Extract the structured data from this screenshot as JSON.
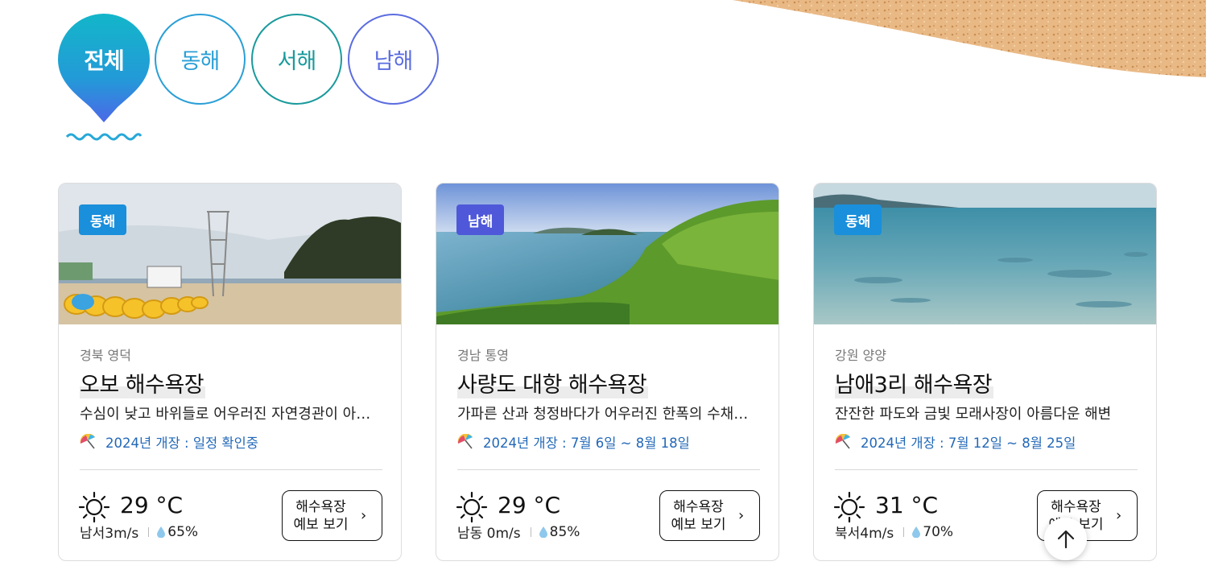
{
  "tabs": [
    {
      "label": "전체",
      "active": true
    },
    {
      "label": "동해",
      "active": false
    },
    {
      "label": "서해",
      "active": false
    },
    {
      "label": "남해",
      "active": false
    }
  ],
  "colors": {
    "east": "#1a8fdb",
    "south": "#4f58d9",
    "link": "#2268b8"
  },
  "cards": [
    {
      "badge": "동해",
      "region": "경북 영덕",
      "name": "오보 해수욕장",
      "description": "수심이 낮고 바위들로 어우러진 자연경관이 아름다운 해변",
      "opening": "2024년 개장 : 일정 확인중",
      "weather_icon": "sun-icon",
      "temperature": "29",
      "temp_unit": "°C",
      "wind": "남서3m/s",
      "humidity": "65%",
      "forecast_button": "해수욕장\n예보 보기"
    },
    {
      "badge": "남해",
      "region": "경남 통영",
      "name": "사량도 대항 해수욕장",
      "description": "가파른 산과 청정바다가 어우러진 한폭의 수채화 같은 해변",
      "opening": "2024년 개장 : 7월 6일 ~ 8월 18일",
      "weather_icon": "sun-icon",
      "temperature": "29",
      "temp_unit": "°C",
      "wind": "남동 0m/s",
      "humidity": "85%",
      "forecast_button": "해수욕장\n예보 보기"
    },
    {
      "badge": "동해",
      "region": "강원 양양",
      "name": "남애3리 해수욕장",
      "description": "잔잔한 파도와 금빛 모래사장이 아름다운 해변",
      "opening": "2024년 개장 : 7월 12일 ~ 8월 25일",
      "weather_icon": "sun-icon",
      "temperature": "31",
      "temp_unit": "°C",
      "wind": "북서4m/s",
      "humidity": "70%",
      "forecast_button": "해수욕장\n예보 보기"
    }
  ]
}
